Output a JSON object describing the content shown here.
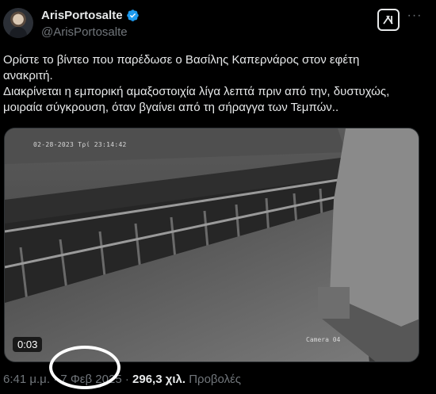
{
  "author": {
    "display_name": "ArisPortosalte",
    "handle": "@ArisPortosalte"
  },
  "icons": {
    "verified": "verified-badge-icon",
    "grok": "grok-icon",
    "more": "more-options-icon"
  },
  "tweet": {
    "line1": "Ορίστε το βίντεο που παρέδωσε ο Βασίλης Καπερνάρος στον εφέτη",
    "line2": "ανακριτή.",
    "line3": "Διακρίνεται η εμπορική αμαξοστοιχία λίγα λεπτά πριν από την, δυστυχώς,",
    "line4": "μοιραία σύγκρουση, όταν βγαίνει από τη σήραγγα των Τεμπών.."
  },
  "video": {
    "overlay_timestamp": "02-28-2023 Τρί 23:14:42",
    "camera_label": "Camera 04",
    "duration": "0:03"
  },
  "meta": {
    "time": "6:41 μ.μ.",
    "separator": "·",
    "date": "7 Φεβ 2025",
    "views_count": "296,3 χιλ.",
    "views_label": "Προβολές"
  },
  "colors": {
    "background": "#000000",
    "text_primary": "#e7e9ea",
    "text_secondary": "#71767b",
    "verified_blue": "#1d9bf0"
  }
}
